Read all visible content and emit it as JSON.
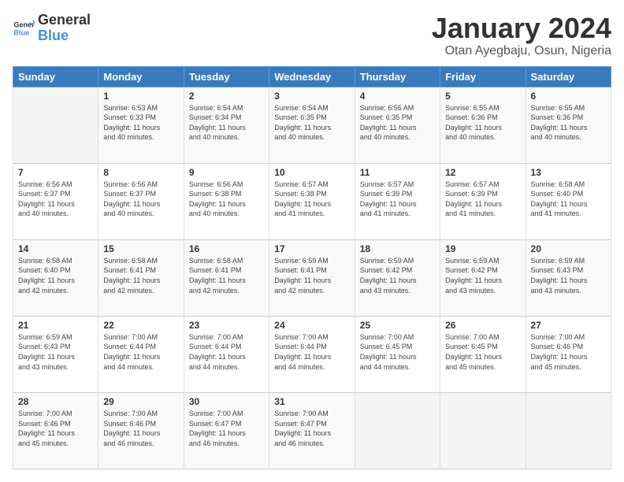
{
  "logo": {
    "text_general": "General",
    "text_blue": "Blue"
  },
  "header": {
    "title": "January 2024",
    "subtitle": "Otan Ayegbaju, Osun, Nigeria"
  },
  "weekdays": [
    "Sunday",
    "Monday",
    "Tuesday",
    "Wednesday",
    "Thursday",
    "Friday",
    "Saturday"
  ],
  "weeks": [
    [
      {
        "day": "",
        "info": ""
      },
      {
        "day": "1",
        "info": "Sunrise: 6:53 AM\nSunset: 6:33 PM\nDaylight: 11 hours\nand 40 minutes."
      },
      {
        "day": "2",
        "info": "Sunrise: 6:54 AM\nSunset: 6:34 PM\nDaylight: 11 hours\nand 40 minutes."
      },
      {
        "day": "3",
        "info": "Sunrise: 6:54 AM\nSunset: 6:35 PM\nDaylight: 11 hours\nand 40 minutes."
      },
      {
        "day": "4",
        "info": "Sunrise: 6:55 AM\nSunset: 6:35 PM\nDaylight: 11 hours\nand 40 minutes."
      },
      {
        "day": "5",
        "info": "Sunrise: 6:55 AM\nSunset: 6:36 PM\nDaylight: 11 hours\nand 40 minutes."
      },
      {
        "day": "6",
        "info": "Sunrise: 6:55 AM\nSunset: 6:36 PM\nDaylight: 11 hours\nand 40 minutes."
      }
    ],
    [
      {
        "day": "7",
        "info": "Sunrise: 6:56 AM\nSunset: 6:37 PM\nDaylight: 11 hours\nand 40 minutes."
      },
      {
        "day": "8",
        "info": "Sunrise: 6:56 AM\nSunset: 6:37 PM\nDaylight: 11 hours\nand 40 minutes."
      },
      {
        "day": "9",
        "info": "Sunrise: 6:56 AM\nSunset: 6:38 PM\nDaylight: 11 hours\nand 40 minutes."
      },
      {
        "day": "10",
        "info": "Sunrise: 6:57 AM\nSunset: 6:38 PM\nDaylight: 11 hours\nand 41 minutes."
      },
      {
        "day": "11",
        "info": "Sunrise: 6:57 AM\nSunset: 6:39 PM\nDaylight: 11 hours\nand 41 minutes."
      },
      {
        "day": "12",
        "info": "Sunrise: 6:57 AM\nSunset: 6:39 PM\nDaylight: 11 hours\nand 41 minutes."
      },
      {
        "day": "13",
        "info": "Sunrise: 6:58 AM\nSunset: 6:40 PM\nDaylight: 11 hours\nand 41 minutes."
      }
    ],
    [
      {
        "day": "14",
        "info": "Sunrise: 6:58 AM\nSunset: 6:40 PM\nDaylight: 11 hours\nand 42 minutes."
      },
      {
        "day": "15",
        "info": "Sunrise: 6:58 AM\nSunset: 6:41 PM\nDaylight: 11 hours\nand 42 minutes."
      },
      {
        "day": "16",
        "info": "Sunrise: 6:58 AM\nSunset: 6:41 PM\nDaylight: 11 hours\nand 42 minutes."
      },
      {
        "day": "17",
        "info": "Sunrise: 6:59 AM\nSunset: 6:41 PM\nDaylight: 11 hours\nand 42 minutes."
      },
      {
        "day": "18",
        "info": "Sunrise: 6:59 AM\nSunset: 6:42 PM\nDaylight: 11 hours\nand 43 minutes."
      },
      {
        "day": "19",
        "info": "Sunrise: 6:59 AM\nSunset: 6:42 PM\nDaylight: 11 hours\nand 43 minutes."
      },
      {
        "day": "20",
        "info": "Sunrise: 6:59 AM\nSunset: 6:43 PM\nDaylight: 11 hours\nand 43 minutes."
      }
    ],
    [
      {
        "day": "21",
        "info": "Sunrise: 6:59 AM\nSunset: 6:43 PM\nDaylight: 11 hours\nand 43 minutes."
      },
      {
        "day": "22",
        "info": "Sunrise: 7:00 AM\nSunset: 6:44 PM\nDaylight: 11 hours\nand 44 minutes."
      },
      {
        "day": "23",
        "info": "Sunrise: 7:00 AM\nSunset: 6:44 PM\nDaylight: 11 hours\nand 44 minutes."
      },
      {
        "day": "24",
        "info": "Sunrise: 7:00 AM\nSunset: 6:44 PM\nDaylight: 11 hours\nand 44 minutes."
      },
      {
        "day": "25",
        "info": "Sunrise: 7:00 AM\nSunset: 6:45 PM\nDaylight: 11 hours\nand 44 minutes."
      },
      {
        "day": "26",
        "info": "Sunrise: 7:00 AM\nSunset: 6:45 PM\nDaylight: 11 hours\nand 45 minutes."
      },
      {
        "day": "27",
        "info": "Sunrise: 7:00 AM\nSunset: 6:46 PM\nDaylight: 11 hours\nand 45 minutes."
      }
    ],
    [
      {
        "day": "28",
        "info": "Sunrise: 7:00 AM\nSunset: 6:46 PM\nDaylight: 11 hours\nand 45 minutes."
      },
      {
        "day": "29",
        "info": "Sunrise: 7:00 AM\nSunset: 6:46 PM\nDaylight: 11 hours\nand 46 minutes."
      },
      {
        "day": "30",
        "info": "Sunrise: 7:00 AM\nSunset: 6:47 PM\nDaylight: 11 hours\nand 46 minutes."
      },
      {
        "day": "31",
        "info": "Sunrise: 7:00 AM\nSunset: 6:47 PM\nDaylight: 11 hours\nand 46 minutes."
      },
      {
        "day": "",
        "info": ""
      },
      {
        "day": "",
        "info": ""
      },
      {
        "day": "",
        "info": ""
      }
    ]
  ]
}
